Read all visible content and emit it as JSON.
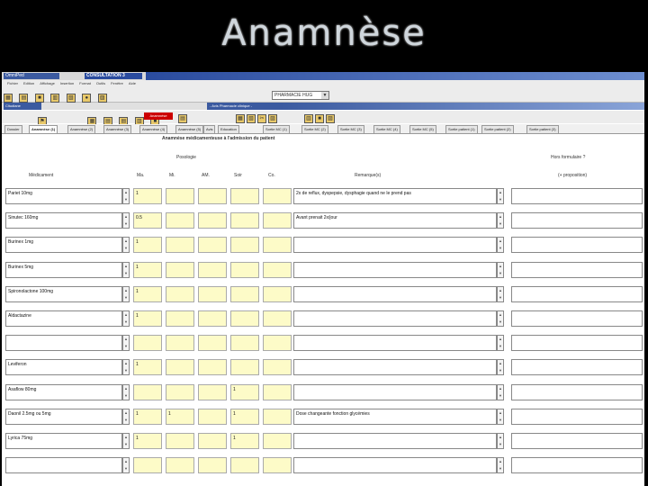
{
  "slide_title": "Anamnèse",
  "app": {
    "window_title": "OmniPed",
    "consult_title": "CONSULTATION 3",
    "menu": [
      "Fichier",
      "Edition",
      "Affichage",
      "Insertion",
      "Format",
      "Outils",
      "Fenêtre",
      "Aide"
    ],
    "top_select": "PHARMACIE HUG",
    "subwindow_title": "Cltudiane",
    "banner": "- Avis Pharmacie clinique -",
    "red_button": "Anamnèse",
    "tabs": [
      "Dossier",
      "Anamnèse (1)",
      "Anamnèse (2)",
      "Anamnèse (3)",
      "Anamnèse (4)",
      "Anamnèse (5)",
      "Avis",
      "Education",
      "Sortie MC (1)",
      "Sortie MC (2)",
      "Sortie MC (3)",
      "Sortie MC (4)",
      "Sortie MC (5)",
      "Sortie patient (1)",
      "Sortie patient (2)",
      "Sortie patient (3)"
    ]
  },
  "form": {
    "section_title": "Anamnèse médicamenteuse à l'admission du patient",
    "posologie_label": "Posologie",
    "hors_formulaire_label": "Hors formulaire ?",
    "headers": {
      "medicament": "Médicament",
      "matin": "Ma.",
      "midi": "Mi.",
      "apres_midi": "AM.",
      "soir": "Soir",
      "coucher": "Co.",
      "remarques": "Remarque(s)",
      "proposition": "(+ proposition)"
    },
    "rows": [
      {
        "med": "Pariet 10mg",
        "ma": "1",
        "mi": "",
        "am": "",
        "soir": "",
        "co": "",
        "remarque": "2x de reflux, dyspepsie, dysphagie quand ne le prend pas",
        "prop": ""
      },
      {
        "med": "Sinutec 160mg",
        "ma": "0.5",
        "mi": "",
        "am": "",
        "soir": "",
        "co": "",
        "remarque": "Avant prenait 2x/jour",
        "prop": ""
      },
      {
        "med": "Burinex 1mg",
        "ma": "1",
        "mi": "",
        "am": "",
        "soir": "",
        "co": "",
        "remarque": "",
        "prop": ""
      },
      {
        "med": "Burinex 5mg",
        "ma": "1",
        "mi": "",
        "am": "",
        "soir": "",
        "co": "",
        "remarque": "",
        "prop": ""
      },
      {
        "med": "Spironolactone 100mg",
        "ma": "1",
        "mi": "",
        "am": "",
        "soir": "",
        "co": "",
        "remarque": "",
        "prop": ""
      },
      {
        "med": "Aldactazine",
        "ma": "1",
        "mi": "",
        "am": "",
        "soir": "",
        "co": "",
        "remarque": "",
        "prop": ""
      },
      {
        "med": "",
        "ma": "",
        "mi": "",
        "am": "",
        "soir": "",
        "co": "",
        "remarque": "",
        "prop": ""
      },
      {
        "med": "Leviferon",
        "ma": "1",
        "mi": "",
        "am": "",
        "soir": "",
        "co": "",
        "remarque": "",
        "prop": ""
      },
      {
        "med": "Asaflow 80mg",
        "ma": "",
        "mi": "",
        "am": "",
        "soir": "1",
        "co": "",
        "remarque": "",
        "prop": ""
      },
      {
        "med": "Daonil 2.5mg ou 5mg",
        "ma": "1",
        "mi": "1",
        "am": "",
        "soir": "1",
        "co": "",
        "remarque": "Dose changeante fonction glycémies",
        "prop": ""
      },
      {
        "med": "Lyrica 75mg",
        "ma": "1",
        "mi": "",
        "am": "",
        "soir": "1",
        "co": "",
        "remarque": "",
        "prop": ""
      },
      {
        "med": "",
        "ma": "",
        "mi": "",
        "am": "",
        "soir": "",
        "co": "",
        "remarque": "",
        "prop": ""
      }
    ]
  }
}
